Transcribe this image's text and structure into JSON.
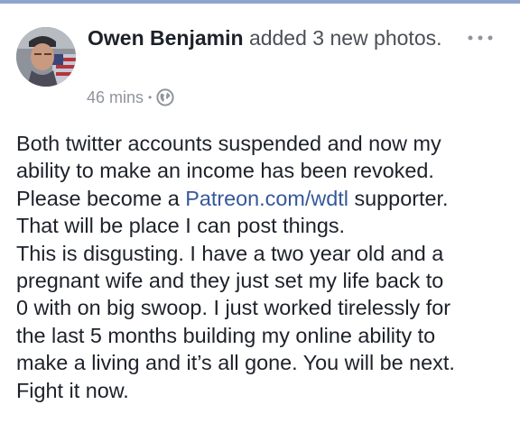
{
  "post": {
    "author": {
      "name": "Owen Benjamin",
      "action": "added 3 new photos."
    },
    "timestamp": "46 mins",
    "meta_separator": "•",
    "privacy_icon": "globe-icon",
    "more_icon": "more-options-icon",
    "body": {
      "line1": "Both twitter accounts suspended and now my",
      "line2": "ability to make an income has been revoked.",
      "line3_prefix": "Please become a ",
      "link": "Patreon.com/wdtl",
      "line3_suffix": " supporter.",
      "line4": "That will be place I can post things.",
      "line5": "This is disgusting. I have a two year old and a",
      "line6": "pregnant wife and they just set my life back to",
      "line7": "0 with on big swoop. I just worked tirelessly for",
      "line8": "the last 5 months building my online ability to",
      "line9": "make a living and it’s all gone. You will be next.",
      "line10": "Fight it now."
    }
  },
  "colors": {
    "name": "#1d2129",
    "secondary_text": "#90949c",
    "link": "#365899",
    "body_text": "#1d2129"
  }
}
